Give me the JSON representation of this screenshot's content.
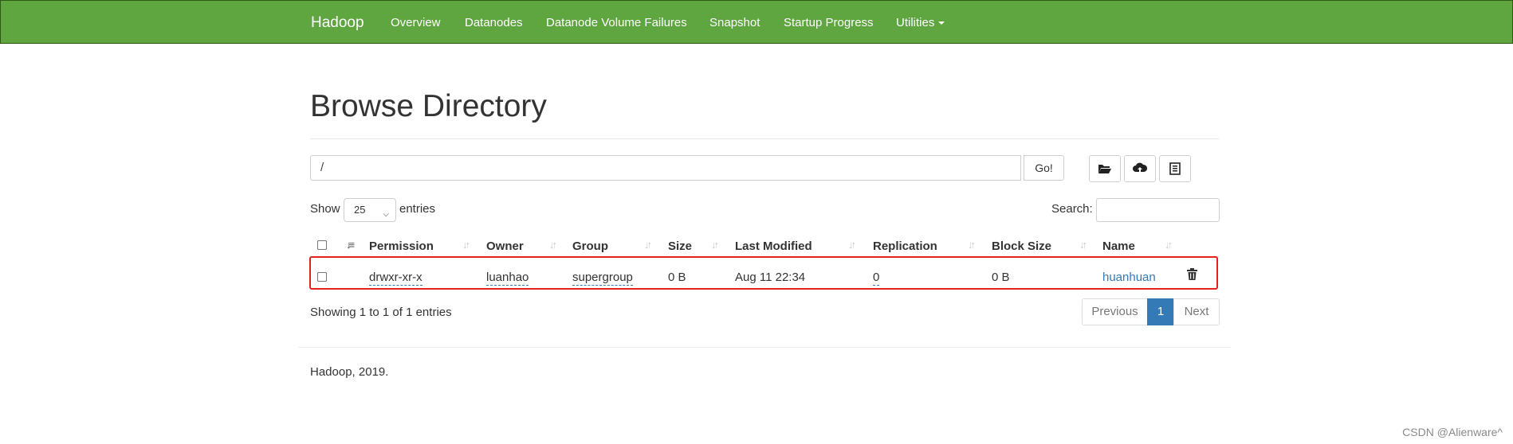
{
  "navbar": {
    "brand": "Hadoop",
    "items": [
      "Overview",
      "Datanodes",
      "Datanode Volume Failures",
      "Snapshot",
      "Startup Progress",
      "Utilities"
    ],
    "background": "#5fa540"
  },
  "page_title": "Browse Directory",
  "path_bar": {
    "value": "/",
    "go_label": "Go!"
  },
  "toolbar_icons": [
    "create-directory-icon",
    "upload-icon",
    "cut-paste-icon"
  ],
  "entries": {
    "show_label": "Show",
    "page_size": "25",
    "entries_label": "entries"
  },
  "search": {
    "label": "Search:",
    "value": ""
  },
  "table": {
    "columns": [
      "Permission",
      "Owner",
      "Group",
      "Size",
      "Last Modified",
      "Replication",
      "Block Size",
      "Name"
    ],
    "rows": [
      {
        "permission": "drwxr-xr-x",
        "owner": "luanhao",
        "group": "supergroup",
        "size": "0 B",
        "last_modified": "Aug 11 22:34",
        "replication": "0",
        "block_size": "0 B",
        "name": "huanhuan"
      }
    ],
    "highlight_color": "#e8201c"
  },
  "footer": {
    "showing": "Showing 1 to 1 of 1 entries",
    "pagination": {
      "previous": "Previous",
      "current": "1",
      "next": "Next"
    },
    "copyright": "Hadoop, 2019."
  },
  "watermark": "CSDN @Alienware^"
}
